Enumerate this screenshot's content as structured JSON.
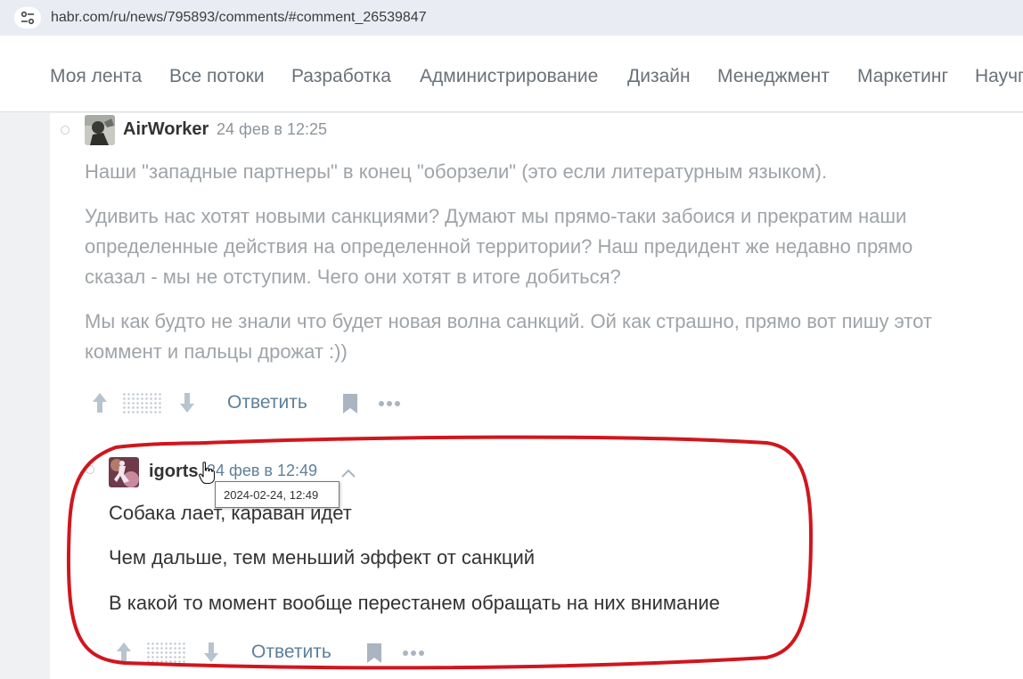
{
  "browser": {
    "url": "habr.com/ru/news/795893/comments/#comment_26539847",
    "site_info_icon": "tune-icon"
  },
  "nav": {
    "items": [
      "Моя лента",
      "Все потоки",
      "Разработка",
      "Администрирование",
      "Дизайн",
      "Менеджмент",
      "Маркетинг",
      "Научп"
    ]
  },
  "comments": [
    {
      "username": "AirWorker",
      "time": "24 фев в 12:25",
      "paragraphs": [
        "Наши \"западные партнеры\" в конец \"оборзели\" (это если литературным языком).",
        "Удивить нас хотят новыми санкциями? Думают мы прямо-таки забоися и прекратим наши",
        "определенные действия на определенной территории? Наш предидент же недавно прямо",
        "сказал - мы не отступим. Чего они хотят в итоге добиться?",
        "Мы как будто не знали что будет новая волна санкций. Ой как страшно, прямо вот пишу этот",
        "коммент и пальцы дрожат :))"
      ],
      "reply_label": "Ответить"
    },
    {
      "username": "igorts",
      "time": "24 фев в 12:49",
      "paragraphs": [
        "Собака лает, караван идет",
        "Чем дальше, тем меньший эффект от санкций",
        "В какой то момент вообще перестанем обращать на них внимание"
      ],
      "reply_label": "Ответить"
    }
  ],
  "tooltip": {
    "text": "2024-02-24, 12:49"
  },
  "colors": {
    "highlight_ring": "#d0161d",
    "reply_link": "#5e7f98",
    "time_link": "#5e7f98",
    "faded_text": "#9fa4a8"
  }
}
